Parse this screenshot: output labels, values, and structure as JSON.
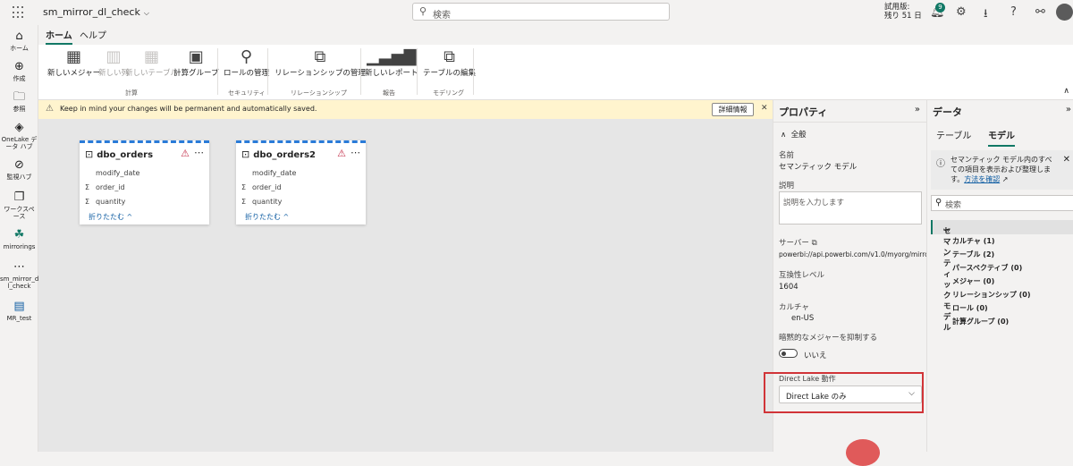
{
  "topbar": {
    "title": "sm_mirror_dl_check",
    "search_placeholder": "検索",
    "trial_line1": "試用版:",
    "trial_line2": "残り 51 日",
    "notification_count": "9"
  },
  "leftnav": {
    "items": [
      {
        "label": "ホーム",
        "icon": "home-icon"
      },
      {
        "label": "作成",
        "icon": "create-icon"
      },
      {
        "label": "参照",
        "icon": "browse-icon"
      },
      {
        "label": "OneLake デ",
        "label2": "ータ ハブ",
        "icon": "onelake-icon"
      },
      {
        "label": "監視ハブ",
        "icon": "monitor-icon"
      },
      {
        "label": "ワークスペ",
        "label2": "ース",
        "icon": "workspace-icon"
      },
      {
        "label": "mirrorings",
        "icon": "mirrorings-icon"
      },
      {
        "label": "sm_mirror_d",
        "label2": "l_check",
        "icon": "semantic-model-icon"
      },
      {
        "label": "MR_test",
        "icon": "report-icon"
      }
    ]
  },
  "ribbon": {
    "tabs": [
      "ホーム",
      "ヘルプ"
    ],
    "buttons": {
      "new_measure": "新しいメジャー",
      "new_column": "新しい列",
      "new_table": "新しいテーブル",
      "calc_group": "計算グループ",
      "manage_roles": "ロールの管理",
      "manage_relationships": "リレーションシップの管理",
      "new_report": "新しいレポート",
      "edit_tables": "テーブルの編集"
    },
    "groups": {
      "calc": "計算",
      "security": "セキュリティ",
      "relationships": "リレーションシップ",
      "report": "報告",
      "modeling": "モデリング"
    }
  },
  "banner": {
    "message": "Keep in mind your changes will be permanent and automatically saved.",
    "details_button": "詳細情報"
  },
  "tables": [
    {
      "name": "dbo_orders",
      "fields": [
        {
          "name": "modify_date",
          "sigma": ""
        },
        {
          "name": "order_id",
          "sigma": "Σ"
        },
        {
          "name": "quantity",
          "sigma": "Σ"
        }
      ],
      "collapse": "折りたたむ ^"
    },
    {
      "name": "dbo_orders2",
      "fields": [
        {
          "name": "modify_date",
          "sigma": ""
        },
        {
          "name": "order_id",
          "sigma": "Σ"
        },
        {
          "name": "quantity",
          "sigma": "Σ"
        }
      ],
      "collapse": "折りたたむ ^"
    }
  ],
  "properties": {
    "title": "プロパティ",
    "section": "全般",
    "name_label": "名前",
    "name_value": "セマンティック モデル",
    "desc_label": "説明",
    "desc_placeholder": "説明を入力します",
    "server_label": "サーバー",
    "server_value": "powerbi://api.powerbi.com/v1.0/myorg/mirrorings",
    "compat_label": "互換性レベル",
    "compat_value": "1604",
    "culture_label": "カルチャ",
    "culture_value": "en-US",
    "implicit_label": "暗黙的なメジャーを抑制する",
    "implicit_value": "いいえ",
    "directlake_label": "Direct Lake 動作",
    "directlake_value": "Direct Lake のみ"
  },
  "datapanel": {
    "title": "データ",
    "tabs": [
      "テーブル",
      "モデル"
    ],
    "info_text": "セマンティック モデル内のすべての項目を表示および整理します。",
    "info_link": "方法を確認",
    "search_placeholder": "検索",
    "root": "セマンティック モデル",
    "items": [
      {
        "label": "カルチャ (1)",
        "expandable": true
      },
      {
        "label": "テーブル (2)",
        "expandable": true
      },
      {
        "label": "パースペクティブ (0)",
        "expandable": false
      },
      {
        "label": "メジャー (0)",
        "expandable": false
      },
      {
        "label": "リレーションシップ (0)",
        "expandable": false
      },
      {
        "label": "ロール (0)",
        "expandable": false
      },
      {
        "label": "計算グループ (0)",
        "expandable": false
      }
    ]
  }
}
